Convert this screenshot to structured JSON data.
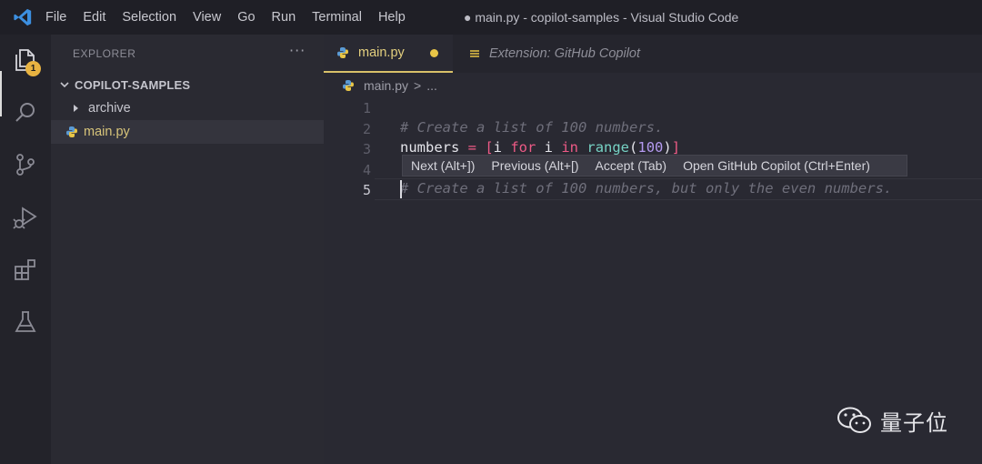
{
  "titlebar": {
    "menu": [
      "File",
      "Edit",
      "Selection",
      "View",
      "Go",
      "Run",
      "Terminal",
      "Help"
    ],
    "window_title": "● main.py - copilot-samples - Visual Studio Code"
  },
  "activitybar": {
    "icons": [
      "files-icon",
      "search-icon",
      "source-control-icon",
      "run-debug-icon",
      "extensions-icon",
      "testing-icon"
    ],
    "explorer_badge": "1"
  },
  "sidebar": {
    "title": "EXPLORER",
    "more": "···",
    "folder": "COPILOT-SAMPLES",
    "items": [
      {
        "label": "archive",
        "type": "folder"
      },
      {
        "label": "main.py",
        "type": "python-file"
      }
    ]
  },
  "tabs": [
    {
      "label": "main.py",
      "modified": true,
      "active": true
    },
    {
      "label": "Extension: GitHub Copilot",
      "active": false
    }
  ],
  "breadcrumb": {
    "file": "main.py",
    "sep": ">",
    "more": "..."
  },
  "editor": {
    "line_numbers": [
      "1",
      "2",
      "3",
      "4",
      "5"
    ],
    "line2_comment": "# Create a list of 100 numbers.",
    "line3": {
      "var": "numbers",
      "eq": " = ",
      "open": "[",
      "i1": "i ",
      "for": "for",
      "i2": " i ",
      "in": "in",
      "sp": " ",
      "range": "range",
      "paren_open": "(",
      "num": "100",
      "paren_close": ")",
      "close": "]"
    },
    "line5_ghost": "# Create a list of 100 numbers, but only the even numbers."
  },
  "suggestion_bar": {
    "items": [
      "Next (Alt+])",
      "Previous (Alt+[)",
      "Accept (Tab)",
      "Open GitHub Copilot (Ctrl+Enter)"
    ]
  },
  "watermark": {
    "text": "量子位"
  },
  "colors": {
    "accent_yellow": "#e8c547",
    "keyword_pink": "#ee5a86",
    "function_teal": "#76d2c4",
    "number_purple": "#b49af0",
    "vscode_blue": "#3c8fe0"
  }
}
